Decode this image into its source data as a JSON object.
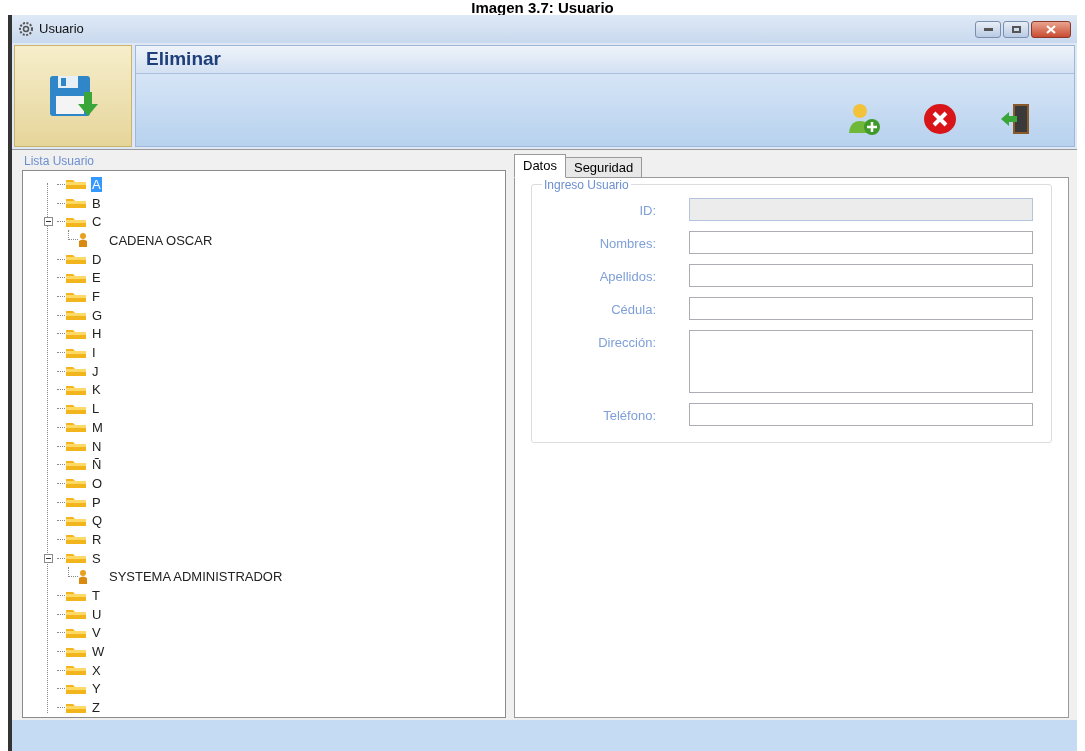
{
  "caption": "Imagen 3.7: Usuario",
  "window": {
    "title": "Usuario"
  },
  "toolbar": {
    "header": "Eliminar"
  },
  "user_list": {
    "title": "Lista Usuario",
    "items": [
      {
        "label": "A",
        "selected": true,
        "expanded": false
      },
      {
        "label": "B",
        "selected": false,
        "expanded": false
      },
      {
        "label": "C",
        "selected": false,
        "expanded": true,
        "children": [
          {
            "label": "CADENA OSCAR",
            "selected": false
          }
        ]
      },
      {
        "label": "D",
        "selected": false,
        "expanded": false
      },
      {
        "label": "E",
        "selected": false,
        "expanded": false
      },
      {
        "label": "F",
        "selected": false,
        "expanded": false
      },
      {
        "label": "G",
        "selected": false,
        "expanded": false
      },
      {
        "label": "H",
        "selected": false,
        "expanded": false
      },
      {
        "label": "I",
        "selected": false,
        "expanded": false
      },
      {
        "label": "J",
        "selected": false,
        "expanded": false
      },
      {
        "label": "K",
        "selected": false,
        "expanded": false
      },
      {
        "label": "L",
        "selected": false,
        "expanded": false
      },
      {
        "label": "M",
        "selected": false,
        "expanded": false
      },
      {
        "label": "N",
        "selected": false,
        "expanded": false
      },
      {
        "label": "Ñ",
        "selected": false,
        "expanded": false
      },
      {
        "label": "O",
        "selected": false,
        "expanded": false
      },
      {
        "label": "P",
        "selected": false,
        "expanded": false
      },
      {
        "label": "Q",
        "selected": false,
        "expanded": false
      },
      {
        "label": "R",
        "selected": false,
        "expanded": false
      },
      {
        "label": "S",
        "selected": false,
        "expanded": true,
        "children": [
          {
            "label": "SYSTEMA ADMINISTRADOR",
            "selected": false
          }
        ]
      },
      {
        "label": "T",
        "selected": false,
        "expanded": false
      },
      {
        "label": "U",
        "selected": false,
        "expanded": false
      },
      {
        "label": "V",
        "selected": false,
        "expanded": false
      },
      {
        "label": "W",
        "selected": false,
        "expanded": false
      },
      {
        "label": "X",
        "selected": false,
        "expanded": false
      },
      {
        "label": "Y",
        "selected": false,
        "expanded": false
      },
      {
        "label": "Z",
        "selected": false,
        "expanded": false
      }
    ]
  },
  "tabs": [
    {
      "label": "Datos",
      "selected": true
    },
    {
      "label": "Seguridad",
      "selected": false
    }
  ],
  "form": {
    "title": "Ingreso Usuario",
    "fields": [
      {
        "label": "ID:",
        "kind": "text",
        "disabled": true
      },
      {
        "label": "Nombres:",
        "kind": "text",
        "disabled": false
      },
      {
        "label": "Apellidos:",
        "kind": "text",
        "disabled": false
      },
      {
        "label": "Cédula:",
        "kind": "text",
        "disabled": false
      },
      {
        "label": "Dirección:",
        "kind": "multiline",
        "disabled": false
      },
      {
        "label": "Teléfono:",
        "kind": "text",
        "disabled": false
      }
    ]
  }
}
